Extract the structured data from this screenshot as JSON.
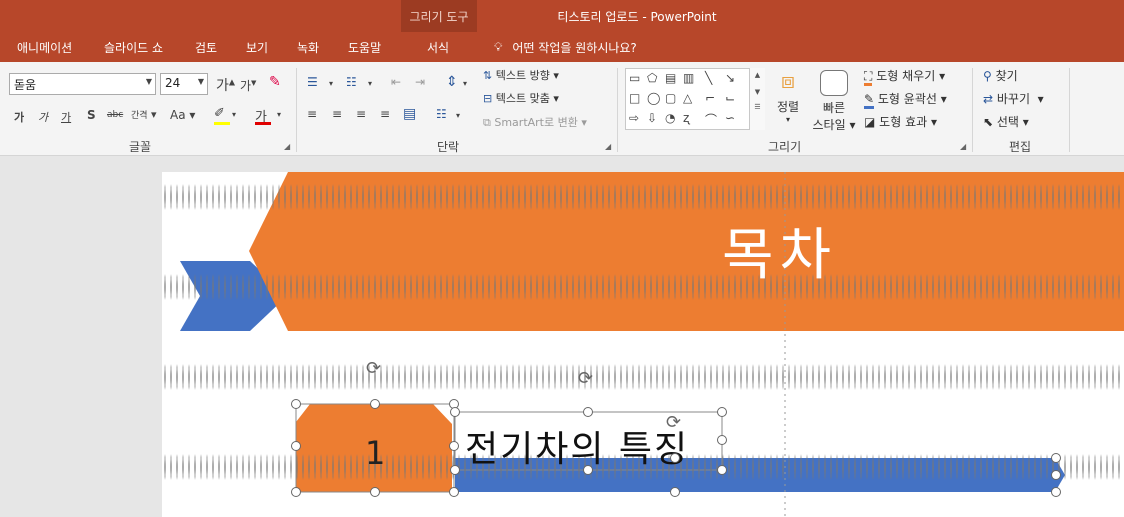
{
  "window": {
    "context_group": "그리기 도구",
    "title": "티스토리 업로드 - PowerPoint"
  },
  "menu": {
    "tabs": [
      "애니메이션",
      "슬라이드 쇼",
      "검토",
      "보기",
      "녹화",
      "도움말"
    ],
    "context_tab": "서식",
    "tell_me": "어떤 작업을 원하시나요?"
  },
  "ribbon": {
    "font": {
      "label": "글꼴",
      "font_name": "돋움",
      "font_size": "24",
      "grow": "가",
      "shrink": "가",
      "bold": "가",
      "italic": "가",
      "underline": "가",
      "shadow": "S",
      "strike": "abc",
      "spacing": "간격",
      "case": "Aa",
      "font_color": "가"
    },
    "paragraph": {
      "label": "단락",
      "text_direction": "텍스트 방향",
      "align_text": "텍스트 맞춤",
      "smartart": "SmartArt로 변환"
    },
    "drawing": {
      "label": "그리기",
      "arrange": "정렬",
      "quick_styles_line1": "빠른",
      "quick_styles_line2": "스타일",
      "shape_fill": "도형 채우기",
      "shape_outline": "도형 윤곽선",
      "shape_effects": "도형 효과"
    },
    "editing": {
      "label": "편집",
      "find": "찾기",
      "replace": "바꾸기",
      "select": "선택"
    }
  },
  "slide": {
    "title": "목차",
    "item_number": "1",
    "item_text": "전기차의 특징"
  },
  "colors": {
    "accent_orange": "#ed7d31",
    "accent_blue": "#4472c4",
    "titlebar": "#b7472a"
  }
}
